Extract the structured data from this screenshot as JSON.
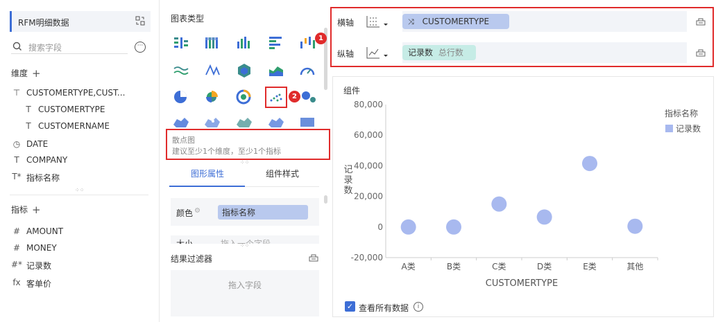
{
  "left": {
    "dataset_name": "RFM明细数据",
    "search_placeholder": "搜索字段",
    "dimension_title": "维度",
    "dimensions": [
      {
        "label": "CUSTOMERTYPE,CUST...",
        "icon": "hierarchy-icon",
        "glyph": "⊤"
      },
      {
        "label": "CUSTOMERTYPE",
        "icon": "text-field-icon",
        "glyph": "T"
      },
      {
        "label": "CUSTOMERNAME",
        "icon": "text-field-icon",
        "glyph": "T"
      },
      {
        "label": "DATE",
        "icon": "clock-icon",
        "glyph": "◷"
      },
      {
        "label": "COMPANY",
        "icon": "text-field-icon",
        "glyph": "T"
      },
      {
        "label": "指标名称",
        "icon": "text-field-calc-icon",
        "glyph": "T*"
      }
    ],
    "metric_title": "指标",
    "metrics": [
      {
        "label": "AMOUNT",
        "icon": "number-field-icon",
        "glyph": "#"
      },
      {
        "label": "MONEY",
        "icon": "number-field-icon",
        "glyph": "#"
      },
      {
        "label": "记录数",
        "icon": "number-calc-icon",
        "glyph": "#*"
      },
      {
        "label": "客单价",
        "icon": "formula-icon",
        "glyph": "fx"
      }
    ]
  },
  "middle": {
    "chart_type_title": "图表类型",
    "chart_desc_name": "散点图",
    "chart_desc_hint": "建议至少1个维度，至少1个指标",
    "tab_shape": "图形属性",
    "tab_style": "组件样式",
    "color_label": "颜色",
    "color_value": "指标名称",
    "size_label": "大小",
    "size_hint": "拖入一个字段",
    "filter_title": "结果过滤器",
    "filter_hint": "拖入字段",
    "badge1": "1",
    "badge2": "2"
  },
  "axis": {
    "x_label": "横轴",
    "x_field": "CUSTOMERTYPE",
    "y_label": "纵轴",
    "y_field": "记录数",
    "y_field_sub": "总行数"
  },
  "widget": {
    "title": "组件",
    "show_all_label": "查看所有数据",
    "show_all_checked": true
  },
  "chart_data": {
    "type": "scatter",
    "categories": [
      "A类",
      "B类",
      "C类",
      "D类",
      "E类",
      "其他"
    ],
    "series": [
      {
        "name": "记录数",
        "values": [
          0,
          0,
          15000,
          6500,
          41500,
          500
        ]
      }
    ],
    "xlabel": "CUSTOMERTYPE",
    "ylabel": "记录数",
    "y_ticks": [
      "80,000",
      "60,000",
      "40,000",
      "20,000",
      "0",
      "-20,000"
    ],
    "ylim": [
      -20000,
      80000
    ],
    "legend_title": "指标名称",
    "legend_position": "top-right",
    "point_color": "#a8b9ef",
    "grid": false
  },
  "colors": {
    "accent": "#3d6ed6",
    "highlight_border": "#e02b2b",
    "pill_blue": "#b9c9ee",
    "pill_teal": "#c6ece6"
  }
}
